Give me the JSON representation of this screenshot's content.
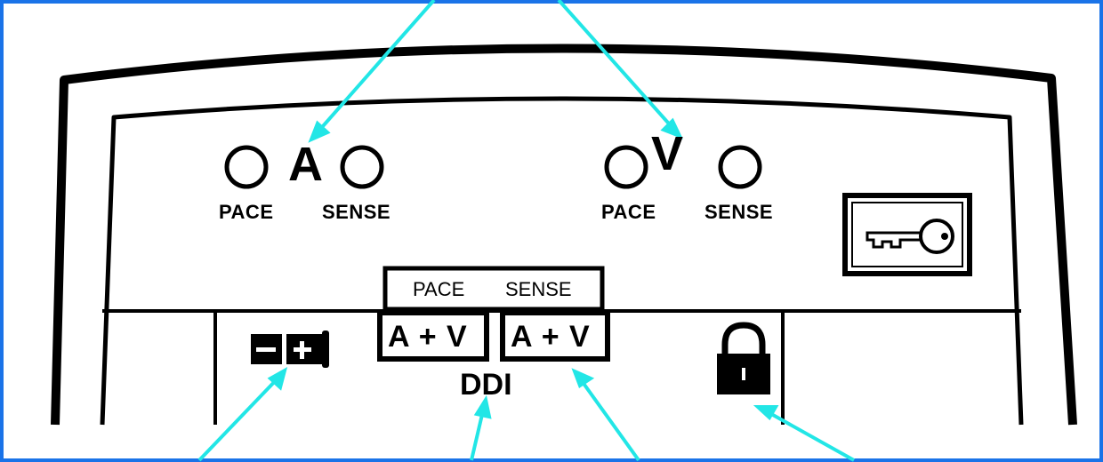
{
  "indicators": {
    "atrial": {
      "chamber": "A",
      "pace": "PACE",
      "sense": "SENSE"
    },
    "ventricular": {
      "chamber": "V",
      "pace": "PACE",
      "sense": "SENSE"
    }
  },
  "ddi_panel": {
    "header_pace": "PACE",
    "header_sense": "SENSE",
    "pace_value": "A + V",
    "sense_value": "A + V",
    "mode": "DDI"
  },
  "icons": [
    "key-icon",
    "battery-icon",
    "lock-icon"
  ],
  "colors": {
    "pointer": "#22e6e6",
    "frame": "#1a73e8",
    "outline": "#000000"
  }
}
